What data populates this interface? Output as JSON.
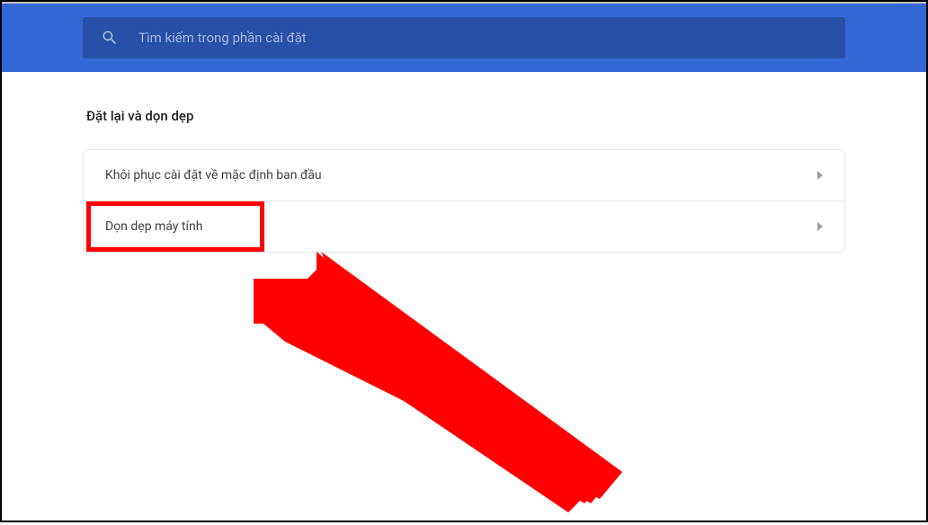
{
  "search": {
    "placeholder": "Tìm kiếm trong phần cài đặt"
  },
  "section": {
    "title": "Đặt lại và dọn dẹp"
  },
  "rows": [
    {
      "label": "Khôi phục cài đặt về mặc định ban đầu"
    },
    {
      "label": "Dọn dẹp máy tính"
    }
  ]
}
